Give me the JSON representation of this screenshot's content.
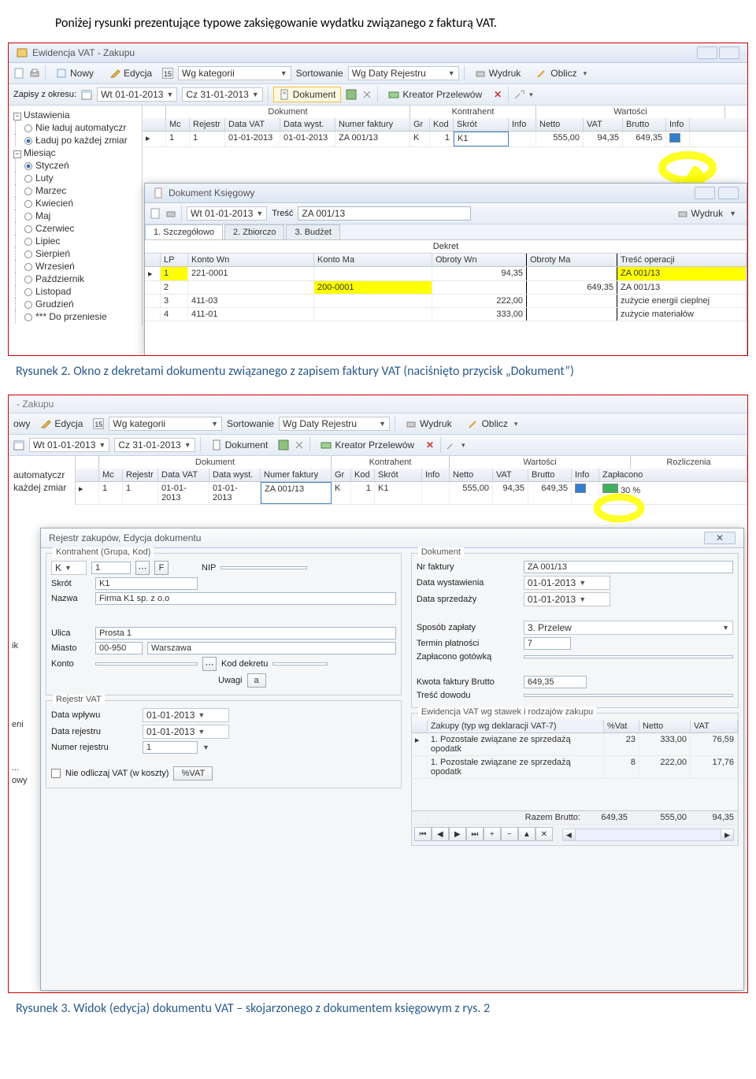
{
  "intro_text": "Poniżej rysunki prezentujące typowe zaksięgowanie wydatku związanego z fakturą VAT.",
  "caption1": "Rysunek 2. Okno z dekretami dokumentu związanego z zapisem faktury VAT  (naciśnięto przycisk „Dokument”)",
  "caption2": "Rysunek 3. Widok (edycja) dokumentu VAT – skojarzonego z dokumentem księgowym z rys. 2",
  "fig1": {
    "window_title": "Ewidencja VAT - Zakupu",
    "tb": {
      "nowy": "Nowy",
      "edycja": "Edycja",
      "wg_kategorii": "Wg kategorii",
      "sortowanie": "Sortowanie",
      "wg_daty": "Wg Daty Rejestru",
      "wydruk": "Wydruk",
      "oblicz": "Oblicz",
      "zapisy_z": "Zapisy z okresu:",
      "date1": "Wt 01-01-2013",
      "date2": "Cz 31-01-2013",
      "dokument": "Dokument",
      "kreator": "Kreator Przelewów"
    },
    "tree": {
      "ustawienia": "Ustawienia",
      "nie_laduj": "Nie ładuj automatyczr",
      "laduj_po": "Ładuj po każdej zmiar",
      "miesiac": "Miesiąc",
      "months": [
        "Styczeń",
        "Luty",
        "Marzec",
        "Kwiecień",
        "Maj",
        "Czerwiec",
        "Lipiec",
        "Sierpień",
        "Wrzesień",
        "Październik",
        "Listopad",
        "Grudzień"
      ],
      "do_przen": "*** Do przeniesie"
    },
    "grid": {
      "groups": {
        "dokument": "Dokument",
        "kontrahent": "Kontrahent",
        "wartosci": "Wartości"
      },
      "cols": {
        "mc": "Mc",
        "rejestr": "Rejestr",
        "data_vat": "Data VAT",
        "data_wyst": "Data wyst.",
        "numer": "Numer faktury",
        "gr": "Gr",
        "kod": "Kod",
        "skrot": "Skrót",
        "info": "Info",
        "netto": "Netto",
        "vat": "VAT",
        "brutto": "Brutto",
        "info2": "Info"
      },
      "row": {
        "mc": "1",
        "rejestr": "1",
        "data_vat": "01-01-2013",
        "data_wyst": "01-01-2013",
        "numer": "ZA 001/13",
        "gr": "K",
        "kod": "1",
        "skrot": "K1",
        "netto": "555,00",
        "vat": "94,35",
        "brutto": "649,35"
      }
    },
    "inner": {
      "title": "Dokument Księgowy",
      "date": "Wt 01-01-2013",
      "tresc_lbl": "Treść",
      "tresc": "ZA 001/13",
      "wydruk": "Wydruk",
      "tabs": {
        "t1": "1. Szczegółowo",
        "t2": "2. Zbiorczo",
        "t3": "3. Budżet"
      },
      "dekret": "Dekret",
      "cols": {
        "lp": "LP",
        "kwn": "Konto Wn",
        "kma": "Konto Ma",
        "own": "Obroty Wn",
        "oma": "Obroty Ma",
        "tresc": "Treść operacji"
      },
      "rows": [
        {
          "lp": "1",
          "kwn": "221-0001",
          "kma": "",
          "own": "94,35",
          "oma": "",
          "tresc": "ZA 001/13"
        },
        {
          "lp": "2",
          "kwn": "",
          "kma": "200-0001",
          "own": "",
          "oma": "649,35",
          "tresc": "ZA 001/13"
        },
        {
          "lp": "3",
          "kwn": "411-03",
          "kma": "",
          "own": "222,00",
          "oma": "",
          "tresc": "zużycie energii cieplnej"
        },
        {
          "lp": "4",
          "kwn": "411-01",
          "kma": "",
          "own": "333,00",
          "oma": "",
          "tresc": "zużycie materiałów"
        }
      ]
    }
  },
  "fig2": {
    "partial_title": "- Zakupu",
    "tb": {
      "owy": "owy",
      "edycja": "Edycja",
      "wg_kategorii": "Wg kategorii",
      "sortowanie": "Sortowanie",
      "wg_daty": "Wg Daty Rejestru",
      "wydruk": "Wydruk",
      "oblicz": "Oblicz",
      "date1": "Wt 01-01-2013",
      "date2": "Cz 31-01-2013",
      "dokument": "Dokument",
      "kreator": "Kreator Przelewów"
    },
    "grid": {
      "groups": {
        "dokument": "Dokument",
        "kontrahent": "Kontrahent",
        "wartosci": "Wartości",
        "rozl": "Rozliczenia"
      },
      "cols": {
        "mc": "Mc",
        "rejestr": "Rejestr",
        "data_vat": "Data VAT",
        "data_wyst": "Data wyst.",
        "numer": "Numer faktury",
        "gr": "Gr",
        "kod": "Kod",
        "skrot": "Skrót",
        "info": "Info",
        "netto": "Netto",
        "vat": "VAT",
        "brutto": "Brutto",
        "info2": "Info",
        "zapl": "Zapłacono"
      },
      "row": {
        "mc": "1",
        "rejestr": "1",
        "data_vat": "01-01-2013",
        "data_wyst": "01-01-2013",
        "numer": "ZA 001/13",
        "gr": "K",
        "kod": "1",
        "skrot": "K1",
        "netto": "555,00",
        "vat": "94,35",
        "brutto": "649,35",
        "zapl": "30 %"
      }
    },
    "tree_frag": {
      "automatyczr": "automatyczr",
      "kazdej": "każdej zmiar",
      "ik": "ik",
      "eni": "eni",
      "owy": "owy"
    },
    "editor": {
      "title": "Rejestr zakupów,  Edycja dokumentu",
      "kontrahent": {
        "legend": "Kontrahent (Grupa, Kod)",
        "K": "K",
        "F": "F",
        "NIP": "NIP",
        "kod": "1",
        "skrot_lbl": "Skrót",
        "skrot": "K1",
        "nazwa_lbl": "Nazwa",
        "nazwa": "Firma K1 sp. z o.o",
        "ulica_lbl": "Ulica",
        "ulica": "Prosta 1",
        "miasto_lbl": "Miasto",
        "kod_p": "00-950",
        "miasto": "Warszawa",
        "konto_lbl": "Konto",
        "kod_dek": "Kod dekretu",
        "uwagi": "Uwagi",
        "a": "a"
      },
      "dokument": {
        "legend": "Dokument",
        "nr_lbl": "Nr faktury",
        "nr": "ZA 001/13",
        "dw_lbl": "Data wystawienia",
        "dw": "01-01-2013",
        "ds_lbl": "Data sprzedaży",
        "ds": "01-01-2013",
        "sz_lbl": "Sposób zapłaty",
        "sz": "3. Przelew",
        "tp_lbl": "Termin płatności",
        "tp": "7",
        "zg_lbl": "Zapłacono gotówką",
        "kfb_lbl": "Kwota faktury Brutto",
        "kfb": "649,35",
        "td_lbl": "Treść dowodu"
      },
      "rejestr": {
        "legend": "Rejestr VAT",
        "dw_lbl": "Data wpływu",
        "dw": "01-01-2013",
        "dr_lbl": "Data rejestru",
        "dr": "01-01-2013",
        "nr_lbl": "Numer rejestru",
        "nr": "1",
        "nie_odl": "Nie odliczaj VAT (w koszty)",
        "xvat": "%VAT"
      },
      "ewid": {
        "legend": "Ewidencja VAT wg stawek i rodzajów zakupu",
        "col_zakupy": "Zakupy (typ wg deklaracji VAT-7)",
        "col_vat": "%Vat",
        "col_netto": "Netto",
        "col_vat2": "VAT",
        "rows": [
          {
            "typ": "1. Pozostałe związane ze sprzedażą opodatk",
            "pvat": "23",
            "netto": "333,00",
            "vat": "76,59"
          },
          {
            "typ": "1. Pozostałe związane ze sprzedażą opodatk",
            "pvat": "8",
            "netto": "222,00",
            "vat": "17,76"
          }
        ],
        "razem": "Razem Brutto:",
        "razem_v": "649,35",
        "sum_netto": "555,00",
        "sum_vat": "94,35"
      }
    }
  }
}
